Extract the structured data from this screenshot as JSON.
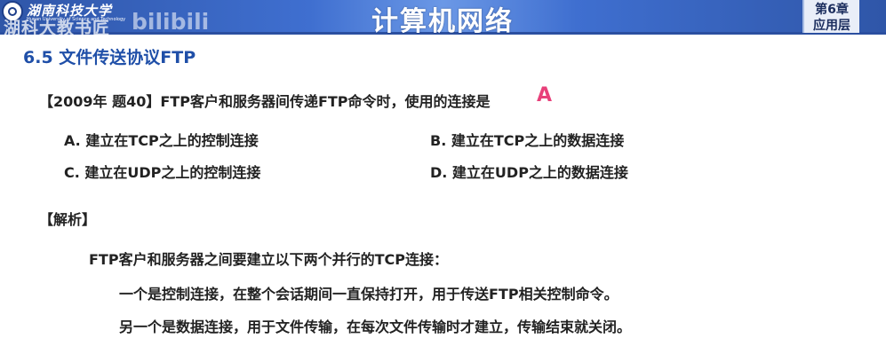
{
  "header": {
    "university_name": "湖南科技大学",
    "university_en": "Hunan University of Science and Technology",
    "overlay_text": "湖科大教书匠",
    "bili_watermark": "bilibili",
    "course_title": "计算机网络",
    "chapter_number": "第6章",
    "chapter_name": "应用层"
  },
  "section_title": "6.5 文件传送协议FTP",
  "question": {
    "text": "【2009年 题40】FTP客户和服务器间传递FTP命令时，使用的连接是",
    "answer": "A",
    "options": [
      "A. 建立在TCP之上的控制连接",
      "B. 建立在TCP之上的数据连接",
      "C. 建立在UDP之上的控制连接",
      "D. 建立在UDP之上的数据连接"
    ]
  },
  "analysis": {
    "label": "【解析】",
    "intro": "FTP客户和服务器之间要建立以下两个并行的TCP连接：",
    "lines": [
      "一个是控制连接，在整个会话期间一直保持打开，用于传送FTP相关控制命令。",
      "另一个是数据连接，用于文件传输，在每次文件传输时才建立，传输结束就关闭。"
    ]
  },
  "colors": {
    "header_blue": "#3f6fd0",
    "section_title_blue": "#1f4fa8",
    "answer_pink": "#e8407a"
  }
}
